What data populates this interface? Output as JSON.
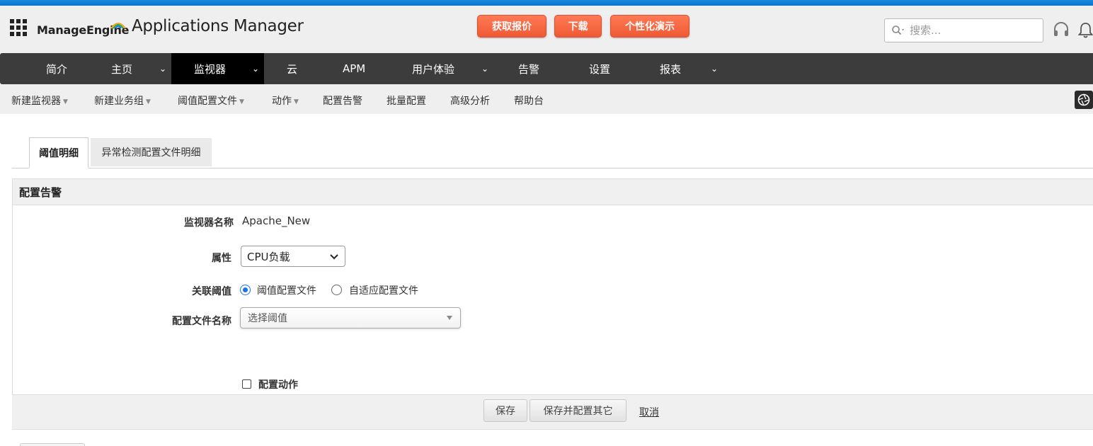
{
  "header": {
    "brand": "ManageEngine",
    "product": "Applications Manager",
    "cta_buttons": [
      {
        "label": "获取报价",
        "color": "#f26a44"
      },
      {
        "label": "下载",
        "color": "#f26a44"
      },
      {
        "label": "个性化演示",
        "color": "#f26a44"
      }
    ],
    "search_placeholder": "搜索..."
  },
  "main_nav": {
    "items": [
      {
        "label": "简介",
        "dropdown": false,
        "active": false
      },
      {
        "label": "主页",
        "dropdown": true,
        "active": false
      },
      {
        "label": "监视器",
        "dropdown": true,
        "active": true
      },
      {
        "label": "云",
        "dropdown": false,
        "active": false
      },
      {
        "label": "APM",
        "dropdown": false,
        "active": false
      },
      {
        "label": "用户体验",
        "dropdown": true,
        "active": false
      },
      {
        "label": "告警",
        "dropdown": false,
        "active": false
      },
      {
        "label": "设置",
        "dropdown": false,
        "active": false
      },
      {
        "label": "报表",
        "dropdown": true,
        "active": false
      }
    ],
    "chevron": "⌄"
  },
  "sub_nav": {
    "items": [
      {
        "label": "新建监视器",
        "dropdown": true
      },
      {
        "label": "新建业务组",
        "dropdown": true
      },
      {
        "label": "阈值配置文件",
        "dropdown": true
      },
      {
        "label": "动作",
        "dropdown": true
      },
      {
        "label": "配置告警",
        "dropdown": false
      },
      {
        "label": "批量配置",
        "dropdown": false
      },
      {
        "label": "高级分析",
        "dropdown": false
      },
      {
        "label": "帮助台",
        "dropdown": false
      }
    ],
    "caret": "▼"
  },
  "tabs": [
    {
      "label": "阈值明细",
      "active": true
    },
    {
      "label": "异常检测配置文件明细",
      "active": false
    }
  ],
  "form": {
    "title": "配置告警",
    "monitor_name_label": "监视器名称",
    "monitor_name_value": "Apache_New",
    "attribute_label": "属性",
    "attribute_value": "CPU负载",
    "associate_label": "关联阈值",
    "radio_options": [
      {
        "label": "阈值配置文件",
        "checked": true
      },
      {
        "label": "自适应配置文件",
        "checked": false
      }
    ],
    "profile_name_label": "配置文件名称",
    "profile_name_placeholder": "选择阈值",
    "configure_action_label": "配置动作",
    "configure_action_checked": false
  },
  "actions": {
    "save": "保存",
    "save_and_configure": "保存并配置其它",
    "cancel": "取消"
  },
  "colors": {
    "top_stripe": "#0c74c8",
    "cta": "#f26a44",
    "nav_bg": "#3c3c3c",
    "nav_active": "#000000",
    "radio_accent": "#1a73e8"
  }
}
